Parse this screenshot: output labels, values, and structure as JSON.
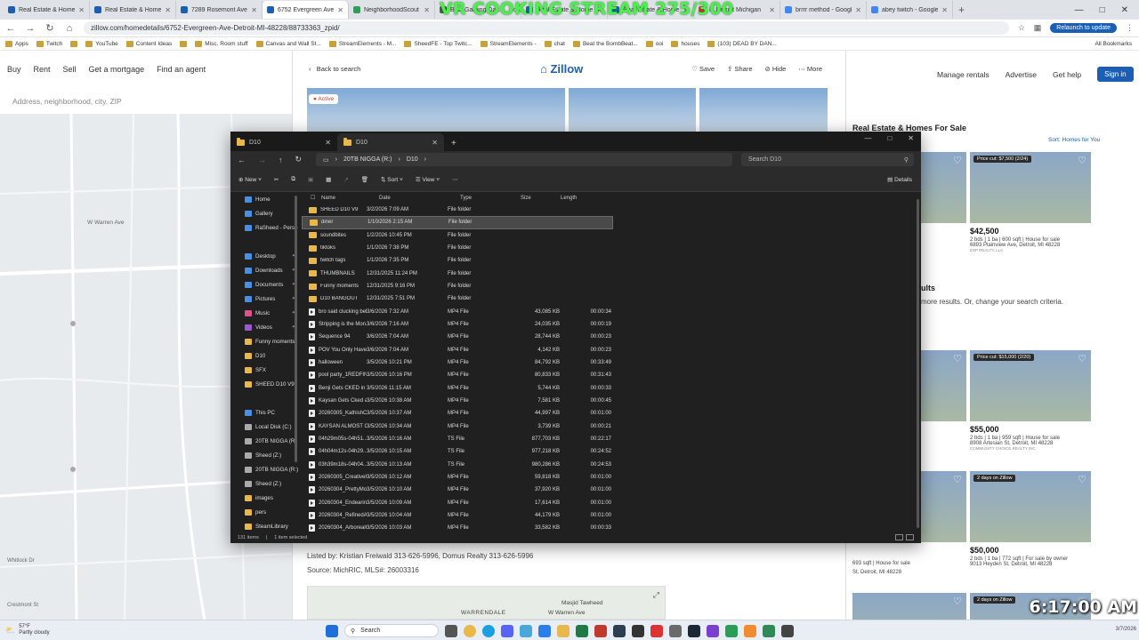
{
  "browser": {
    "tabs": [
      {
        "label": "Real Estate & Homes F",
        "color": "#1a5fb4"
      },
      {
        "label": "Real Estate & Homes F",
        "color": "#1a5fb4"
      },
      {
        "label": "7289 Rosemont Ave, D",
        "color": "#1a5fb4"
      },
      {
        "label": "6752 Evergreen Ave, D",
        "color": "#1a5fb4",
        "active": true
      },
      {
        "label": "NeighborhoodScout",
        "color": "#2e9e55"
      },
      {
        "label": "Best Gaming Dac...",
        "color": "#555555"
      },
      {
        "label": "Real Estate & Homes F",
        "color": "#1a5fb4"
      },
      {
        "label": "Real Estate & Homes F",
        "color": "#1a5fb4"
      },
      {
        "label": "Is Detroit Michigan",
        "color": "#d33"
      },
      {
        "label": "brrrr method - Google",
        "color": "#4285f4"
      },
      {
        "label": "abey twitch - Google S",
        "color": "#4285f4"
      }
    ],
    "url": "zillow.com/homedetails/6752-Evergreen-Ave-Detroit-MI-48228/88733363_zpid/",
    "relaunch": "Relaunch to update",
    "bookmarks": [
      "Apps",
      "Twitch",
      "",
      "YouTube",
      "Content Ideas",
      "",
      "Misc. Room stuff",
      "Canvas and Wall St...",
      "StreamElements - M...",
      "SheedFE - Top Twitc...",
      "StreamElements -",
      "chat",
      "Beat the BombBeat...",
      "ooi",
      "houses",
      "(103) DEAD BY DAN..."
    ],
    "all_bookmarks": "All Bookmarks"
  },
  "overlay_title": "VR COOKING STREAM 275/300",
  "zillow": {
    "nav": [
      "Buy",
      "Rent",
      "Sell",
      "Get a mortgage",
      "Find an agent"
    ],
    "search_placeholder": "Address, neighborhood, city, ZIP",
    "right_nav": [
      "Manage rentals",
      "Advertise",
      "Get help"
    ],
    "sign_in": "Sign in",
    "results_title": "Real Estate & Homes For Sale",
    "sort": "Sort: Homes for You",
    "no_results_1": "ults",
    "no_results_2": "more results. Or, change your search criteria.",
    "detail": {
      "back": "Back to search",
      "logo": "Zillow",
      "actions": [
        "Save",
        "Share",
        "Hide",
        "More"
      ],
      "status": "Active",
      "listed_by": "Listed by: Kristian Freiwald 313-626-5996, Domus Realty 313-626-5996",
      "source": "Source: MichRIC,  MLS#: 26003316",
      "map_labels": [
        "WARRENDALE",
        "W Warren Ave",
        "Masjid Tawheed"
      ]
    },
    "cards": [
      {
        "tag": "Price cut: $7,500 (2/24)",
        "price": "$42,500",
        "meta": "2 bds | 1 ba | 600 sqft | House for sale",
        "addr": "6893 Plainview Ave, Detroit, MI 48228",
        "broker": "EXP REALTY, LLC"
      },
      {
        "tag": "Price cut: $15,000 (2/20)",
        "price": "$55,000",
        "meta": "2 bds | 1 ba | 959 sqft | House for sale",
        "addr": "8908 Artesian St, Detroit, MI 48228",
        "broker": "COMMUNITY CHOICE REALTY INC"
      },
      {
        "tag": "2 days on Zillow",
        "price": "$50,000",
        "meta": "2 bds | 1 ba | 772 sqft | For sale by owner",
        "addr": "9013 Heyden St, Detroit, MI 48228",
        "broker": ""
      },
      {
        "tag": "2 days on Zillow",
        "price": "",
        "meta": "",
        "addr": "",
        "broker": ""
      }
    ],
    "left_partial": [
      "693 sqft | House for sale",
      "St, Detroit, MI 48228"
    ]
  },
  "explorer": {
    "tabs": [
      "D10",
      "D10"
    ],
    "breadcrumb": [
      "20TB NIGGA (R:)",
      "D10"
    ],
    "search_placeholder": "Search D10",
    "toolbar": [
      "New",
      "Sort",
      "View",
      "Details"
    ],
    "columns": [
      "Name",
      "Date",
      "Type",
      "Size",
      "Length"
    ],
    "sidebar": [
      {
        "label": "Home",
        "color": "#4a90e2"
      },
      {
        "label": "Gallery",
        "color": "#4a90e2"
      },
      {
        "label": "RaSheed - Perso",
        "color": "#4a90e2"
      },
      {
        "label": "",
        "color": ""
      },
      {
        "label": "Desktop",
        "color": "#4a90e2",
        "pin": true
      },
      {
        "label": "Downloads",
        "color": "#4a90e2",
        "pin": true
      },
      {
        "label": "Documents",
        "color": "#4a90e2",
        "pin": true
      },
      {
        "label": "Pictures",
        "color": "#4a90e2",
        "pin": true
      },
      {
        "label": "Music",
        "color": "#e0508a",
        "pin": true
      },
      {
        "label": "Videos",
        "color": "#9b59d0",
        "pin": true
      },
      {
        "label": "Funny moments",
        "color": "#e8b84a"
      },
      {
        "label": "D10",
        "color": "#e8b84a"
      },
      {
        "label": "SFX",
        "color": "#e8b84a"
      },
      {
        "label": "SHEED D10 V9",
        "color": "#e8b84a"
      },
      {
        "label": "",
        "color": ""
      },
      {
        "label": "This PC",
        "color": "#4a90e2"
      },
      {
        "label": "Local Disk (C:)",
        "color": "#aaaaaa"
      },
      {
        "label": "20TB NIGGA (R",
        "color": "#aaaaaa"
      },
      {
        "label": "Sheed (Z:)",
        "color": "#aaaaaa"
      },
      {
        "label": "20TB NIGGA (R:)",
        "color": "#aaaaaa"
      },
      {
        "label": "Sheed (Z:)",
        "color": "#aaaaaa"
      },
      {
        "label": "images",
        "color": "#e8b84a"
      },
      {
        "label": "pers",
        "color": "#e8b84a"
      },
      {
        "label": "SteamLibrary",
        "color": "#e8b84a"
      }
    ],
    "rows": [
      {
        "name": "SHEED D10 V9",
        "date": "3/2/2026 7:09 AM",
        "type": "File folder",
        "size": "",
        "length": "",
        "kind": "folder"
      },
      {
        "name": "diner",
        "date": "1/10/2026 2:15 AM",
        "type": "File folder",
        "size": "",
        "length": "",
        "kind": "folder",
        "selected": true
      },
      {
        "name": "soundbites",
        "date": "1/2/2026 10:45 PM",
        "type": "File folder",
        "size": "",
        "length": "",
        "kind": "folder"
      },
      {
        "name": "tiktoks",
        "date": "1/1/2026 7:38 PM",
        "type": "File folder",
        "size": "",
        "length": "",
        "kind": "folder"
      },
      {
        "name": "twitch tags",
        "date": "1/1/2026 7:35 PM",
        "type": "File folder",
        "size": "",
        "length": "",
        "kind": "folder"
      },
      {
        "name": "THUMBNAILS",
        "date": "12/31/2025 11:24 PM",
        "type": "File folder",
        "size": "",
        "length": "",
        "kind": "folder"
      },
      {
        "name": "Funny moments",
        "date": "12/31/2025 9:16 PM",
        "type": "File folder",
        "size": "",
        "length": "",
        "kind": "folder"
      },
      {
        "name": "D10 BANGOUT",
        "date": "12/31/2025 7:51 PM",
        "type": "File folder",
        "size": "",
        "length": "",
        "kind": "folder"
      },
      {
        "name": "bro said clucking bel...",
        "date": "3/6/2026 7:32 AM",
        "type": "MP4 File",
        "size": "43,085 KB",
        "length": "00:00:34",
        "kind": "video"
      },
      {
        "name": "Stripping is the Mon...",
        "date": "3/6/2026 7:16 AM",
        "type": "MP4 File",
        "size": "24,035 KB",
        "length": "00:00:19",
        "kind": "video"
      },
      {
        "name": "Sequence 94",
        "date": "3/6/2026 7:04 AM",
        "type": "MP4 File",
        "size": "28,744 KB",
        "length": "00:00:23",
        "kind": "video"
      },
      {
        "name": "POV You Only Have ...",
        "date": "3/6/2026 7:04 AM",
        "type": "MP4 File",
        "size": "4,142 KB",
        "length": "00:00:23",
        "kind": "video"
      },
      {
        "name": "halloween",
        "date": "3/5/2026 10:21 PM",
        "type": "MP4 File",
        "size": "84,792 KB",
        "length": "00:33:49",
        "kind": "video"
      },
      {
        "name": "pool party_1REDFIN...",
        "date": "3/5/2026 10:16 PM",
        "type": "MP4 File",
        "size": "80,833 KB",
        "length": "00:31:43",
        "kind": "video"
      },
      {
        "name": "Benji Gets CKED in Di...",
        "date": "3/5/2026 11:15 AM",
        "type": "MP4 File",
        "size": "5,744 KB",
        "length": "00:00:33",
        "kind": "video"
      },
      {
        "name": "Kaysan Gets Cked an...",
        "date": "3/5/2026 10:38 AM",
        "type": "MP4 File",
        "size": "7,581 KB",
        "length": "00:00:45",
        "kind": "video"
      },
      {
        "name": "20260305_KathishCa...",
        "date": "3/5/2026 10:37 AM",
        "type": "MP4 File",
        "size": "44,997 KB",
        "length": "00:01:00",
        "kind": "video"
      },
      {
        "name": "KAYSAN ALMOST GE...",
        "date": "3/5/2026 10:34 AM",
        "type": "MP4 File",
        "size": "3,739 KB",
        "length": "00:00:21",
        "kind": "video"
      },
      {
        "name": "04h29m05s-04h51...",
        "date": "3/5/2026 10:16 AM",
        "type": "TS File",
        "size": "877,703 KB",
        "length": "00:22:17",
        "kind": "video"
      },
      {
        "name": "04h04m12s-04h29...",
        "date": "3/5/2026 10:15 AM",
        "type": "TS File",
        "size": "977,218 KB",
        "length": "00:24:52",
        "kind": "video"
      },
      {
        "name": "03h39m18s-04h04...",
        "date": "3/5/2026 10:13 AM",
        "type": "TS File",
        "size": "980,286 KB",
        "length": "00:24:53",
        "kind": "video"
      },
      {
        "name": "20260305_CreativeH...",
        "date": "3/5/2026 10:12 AM",
        "type": "MP4 File",
        "size": "59,818 KB",
        "length": "00:01:00",
        "kind": "video"
      },
      {
        "name": "20260304_PrettyMol...",
        "date": "3/5/2026 10:10 AM",
        "type": "MP4 File",
        "size": "37,920 KB",
        "length": "00:01:00",
        "kind": "video"
      },
      {
        "name": "20260304_Endearing...",
        "date": "3/5/2026 10:09 AM",
        "type": "MP4 File",
        "size": "17,614 KB",
        "length": "00:01:00",
        "kind": "video"
      },
      {
        "name": "20260304_RefinedA...",
        "date": "3/5/2026 10:04 AM",
        "type": "MP4 File",
        "size": "44,179 KB",
        "length": "00:01:00",
        "kind": "video"
      },
      {
        "name": "20260304_ArborealC...",
        "date": "3/5/2026 10:03 AM",
        "type": "MP4 File",
        "size": "33,582 KB",
        "length": "00:00:33",
        "kind": "video"
      }
    ],
    "status_items": "131 items",
    "status_selected": "1 item selected"
  },
  "taskbar": {
    "temp": "57°F",
    "weather": "Partly cloudy",
    "search": "Search",
    "clock": "6:17:00 AM",
    "date": "3/7/2026"
  }
}
